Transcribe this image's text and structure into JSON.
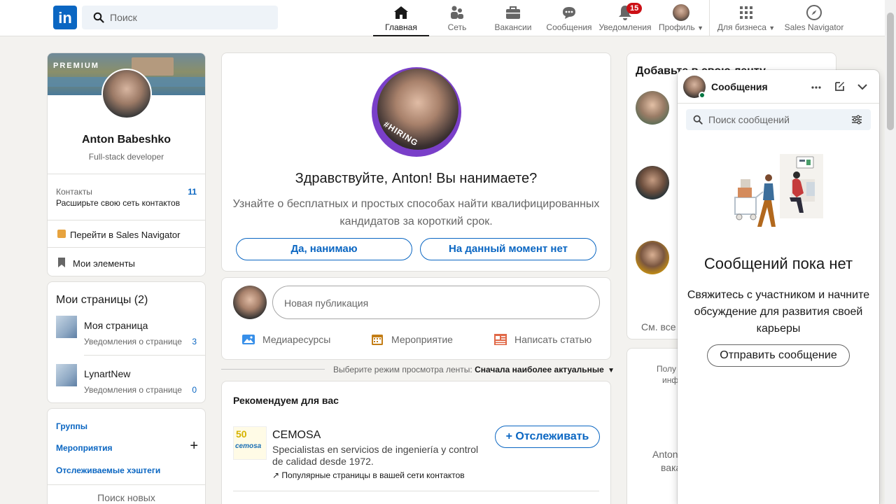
{
  "nav": {
    "search_placeholder": "Поиск",
    "items": [
      {
        "label": "Главная",
        "icon": "home-icon"
      },
      {
        "label": "Сеть",
        "icon": "network-icon"
      },
      {
        "label": "Вакансии",
        "icon": "jobs-icon"
      },
      {
        "label": "Сообщения",
        "icon": "messaging-icon"
      },
      {
        "label": "Уведомления",
        "icon": "bell-icon",
        "badge": "15"
      },
      {
        "label": "Профиль",
        "icon": "avatar-icon"
      },
      {
        "label": "Для бизнеса",
        "icon": "grid-icon"
      },
      {
        "label": "Sales Navigator",
        "icon": "compass-icon"
      }
    ]
  },
  "profile": {
    "premium": "PREMIUM",
    "name": "Anton Babeshko",
    "title": "Full-stack developer",
    "contacts_label": "Контакты",
    "contacts_count": "11",
    "contacts_cta": "Расширьте свою сеть контактов",
    "sales_nav": "Перейти в Sales Navigator",
    "my_items": "Мои элементы"
  },
  "pages": {
    "title": "Мои страницы (2)",
    "items": [
      {
        "name": "Моя страница",
        "sub": "Уведомления о странице",
        "count": "3"
      },
      {
        "name": "LynartNew",
        "sub": "Уведомления о странице",
        "count": "0"
      }
    ]
  },
  "links": {
    "groups": "Группы",
    "events": "Мероприятия",
    "hashtags": "Отслеживаемые хэштеги",
    "discover": "Поиск новых"
  },
  "hiring": {
    "badge": "#HIRING",
    "heading": "Здравствуйте, Anton! Вы нанимаете?",
    "desc": "Узнайте о бесплатных и простых способах найти квалифицированных кандидатов за короткий срок.",
    "yes": "Да, нанимаю",
    "no": "На данный момент нет"
  },
  "share": {
    "placeholder": "Новая публикация",
    "media": "Медиаресурсы",
    "event": "Мероприятие",
    "article": "Написать статью"
  },
  "sort": {
    "label": "Выберите режим просмотра ленты:",
    "value": "Сначала наиболее актуальные"
  },
  "recommend": {
    "title": "Рекомендуем для вас",
    "company": "CEMOSA",
    "logo_text": "cemosa",
    "logo_years": "50",
    "desc": "Specialistas en servicios de ingeniería y control de calidad desde 1972.",
    "meta": "Популярные страницы в вашей сети контактов",
    "follow": "+ Отслеживать"
  },
  "right": {
    "title": "Добавьте в свою ленту",
    "see_all": "См. все",
    "partial1": "Полу",
    "partial2": "инф",
    "partial3": "Anton",
    "partial4": "вака"
  },
  "messaging": {
    "title": "Сообщения",
    "search_placeholder": "Поиск сообщений",
    "empty_title": "Сообщений пока нет",
    "empty_desc": "Свяжитесь с участником и начните обсуждение для развития своей карьеры",
    "send": "Отправить сообщение"
  },
  "colors": {
    "brand": "#0a66c2",
    "notification": "#cc1016",
    "online": "#057642",
    "hiring_purple": "#7a3fc9"
  }
}
